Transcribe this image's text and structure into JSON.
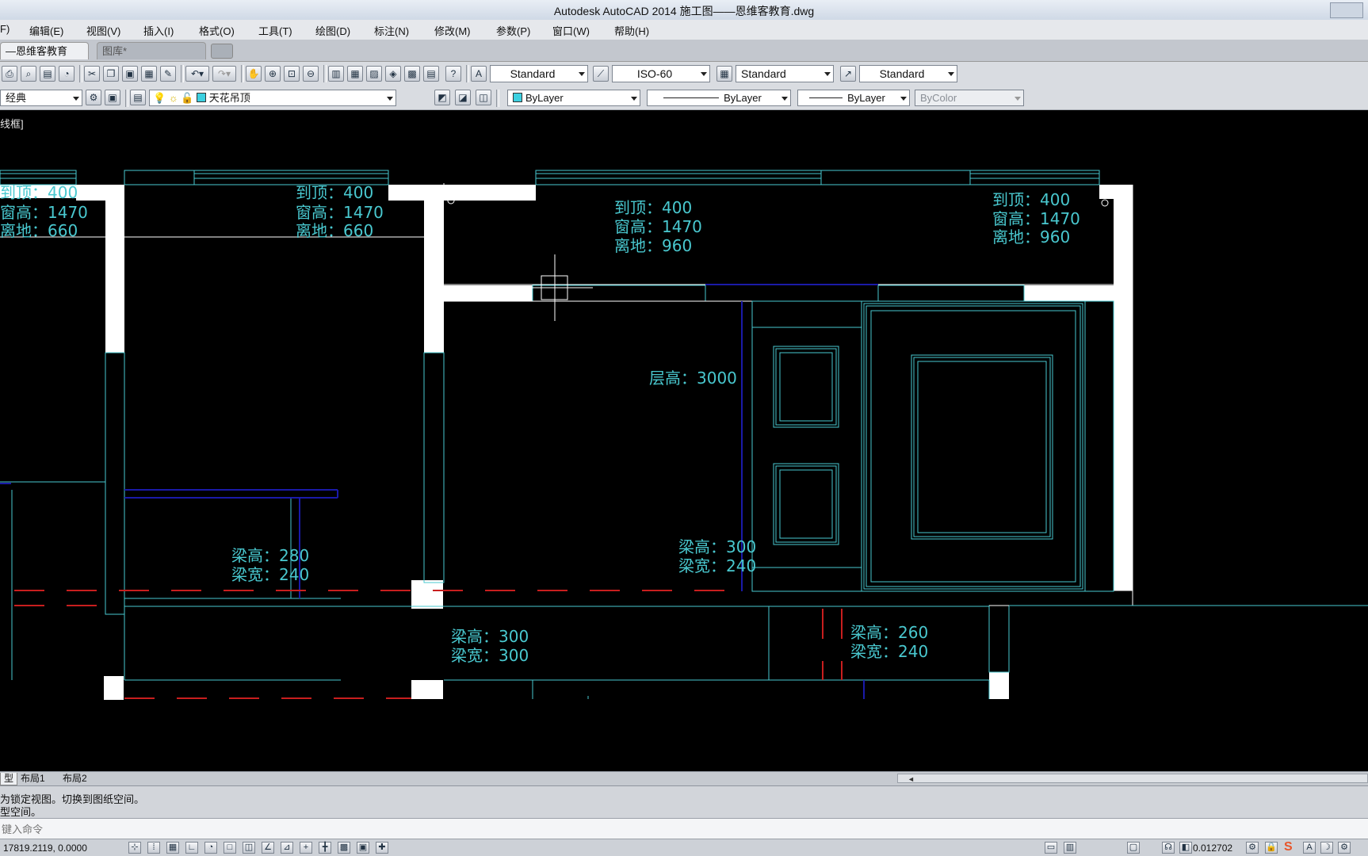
{
  "window": {
    "title": "Autodesk AutoCAD 2014    施工图——恩维客教育.dwg"
  },
  "menu": [
    {
      "label": "F)"
    },
    {
      "label": "编辑(E)"
    },
    {
      "label": "视图(V)"
    },
    {
      "label": "插入(I)"
    },
    {
      "label": "格式(O)"
    },
    {
      "label": "工具(T)"
    },
    {
      "label": "绘图(D)"
    },
    {
      "label": "标注(N)"
    },
    {
      "label": "修改(M)"
    },
    {
      "label": "参数(P)"
    },
    {
      "label": "窗口(W)"
    },
    {
      "label": "帮助(H)"
    }
  ],
  "doc_tabs": [
    {
      "label": "—恩维客教育*",
      "close": "×"
    },
    {
      "label": "图库*"
    }
  ],
  "toolbar": {
    "text_style": "Standard",
    "dim_style": "ISO-60",
    "table_style": "Standard",
    "mleader_style": "Standard",
    "workspace": "经典",
    "layer": "天花吊顶",
    "color": "ByLayer",
    "linetype": "ByLayer",
    "lineweight": "ByLayer",
    "plotstyle": "ByColor"
  },
  "viewport": {
    "label": "线框]"
  },
  "annotations": {
    "w1": [
      "到顶：400",
      "窗高：1470",
      "离地：660"
    ],
    "w2": [
      "到顶：400",
      "窗高：1470",
      "离地：660"
    ],
    "w3": [
      "到顶：400",
      "窗高：1470",
      "离地：960"
    ],
    "w4": [
      "到顶：400",
      "窗高：1470",
      "离地：960"
    ],
    "floor_height": "层高：3000",
    "b1": [
      "梁高：280",
      "梁宽：240"
    ],
    "b2": [
      "梁高：300",
      "梁宽：240"
    ],
    "b3": [
      "梁高：300",
      "梁宽：300"
    ],
    "b4": [
      "梁高：260",
      "梁宽：240"
    ]
  },
  "layout_tabs": [
    {
      "label": "型"
    },
    {
      "label": "布局1"
    },
    {
      "label": "布局2"
    }
  ],
  "command": {
    "history": [
      "为锁定视图。切换到图纸空间。",
      "型空间。"
    ],
    "placeholder": "键入命令"
  },
  "status": {
    "coords": "17819.2119,  0.0000",
    "annotation_scale": "0.012702"
  },
  "colors": {
    "cad_background": "#000000",
    "cyan": "#49c8cf",
    "blue": "#1a1aa8",
    "red": "#c81e1e",
    "white": "#ffffff"
  }
}
